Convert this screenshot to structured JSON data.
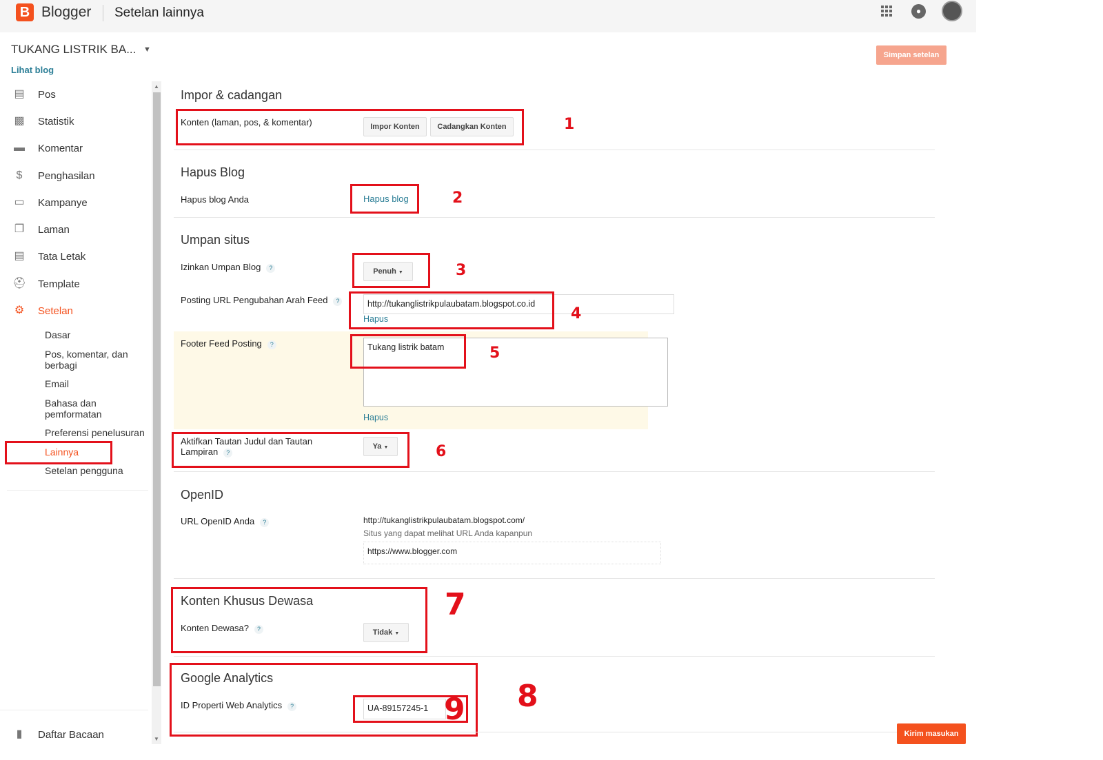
{
  "header": {
    "logo_letter": "B",
    "brand": "Blogger",
    "page_title": "Setelan lainnya",
    "icons": [
      "apps-grid-icon",
      "notifications-bell-icon",
      "account-avatar"
    ]
  },
  "blog": {
    "name": "TUKANG LISTRIK BA...",
    "view_link": "Lihat blog"
  },
  "save_button": "Simpan setelan",
  "sidebar": {
    "items": [
      {
        "label": "Pos",
        "icon": "posts-icon"
      },
      {
        "label": "Statistik",
        "icon": "stats-icon"
      },
      {
        "label": "Komentar",
        "icon": "comments-icon"
      },
      {
        "label": "Penghasilan",
        "icon": "dollar-icon"
      },
      {
        "label": "Kampanye",
        "icon": "ad-icon"
      },
      {
        "label": "Laman",
        "icon": "pages-icon"
      },
      {
        "label": "Tata Letak",
        "icon": "layout-icon"
      },
      {
        "label": "Template",
        "icon": "paint-roller-icon"
      },
      {
        "label": "Setelan",
        "icon": "gear-icon",
        "active": true
      }
    ],
    "subitems": [
      "Dasar",
      "Pos, komentar, dan berbagi",
      "Email",
      "Bahasa dan pemformatan",
      "Preferensi penelusuran",
      "Lainnya",
      "Setelan pengguna"
    ],
    "active_subitem": "Lainnya",
    "reading_list": "Daftar Bacaan"
  },
  "sections": {
    "import": {
      "title": "Impor & cadangan",
      "label": "Konten (laman, pos, & komentar)",
      "import_btn": "Impor Konten",
      "backup_btn": "Cadangkan Konten"
    },
    "delete": {
      "title": "Hapus Blog",
      "label": "Hapus blog Anda",
      "link": "Hapus blog"
    },
    "feed": {
      "title": "Umpan situs",
      "allow_label": "Izinkan Umpan Blog",
      "allow_value": "Penuh",
      "redirect_label": "Posting URL Pengubahan Arah Feed",
      "redirect_value": "http://tukanglistrikpulaubatam.blogspot.co.id",
      "remove": "Hapus",
      "footer_label": "Footer Feed Posting",
      "footer_value": "Tukang listrik batam",
      "footer_remove": "Hapus",
      "title_links_label": "Aktifkan Tautan Judul dan Tautan Lampiran",
      "title_links_value": "Ya"
    },
    "openid": {
      "title": "OpenID",
      "label": "URL OpenID Anda",
      "url": "http://tukanglistrikpulaubatam.blogspot.com/",
      "note": "Situs yang dapat melihat URL Anda kapanpun",
      "sites_value": "https://www.blogger.com"
    },
    "adult": {
      "title": "Konten Khusus Dewasa",
      "label": "Konten Dewasa?",
      "value": "Tidak"
    },
    "analytics": {
      "title": "Google Analytics",
      "label": "ID Properti Web Analytics",
      "value": "UA-89157245-1"
    }
  },
  "help_mark": "?",
  "annotations": [
    "1",
    "2",
    "3",
    "4",
    "5",
    "6",
    "7",
    "8",
    "9"
  ],
  "feedback_button": "Kirim masukan",
  "colors": {
    "accent": "#f4511e",
    "link": "#2b7e96",
    "annotation": "#e3101a",
    "highlight": "#fef9e7"
  }
}
